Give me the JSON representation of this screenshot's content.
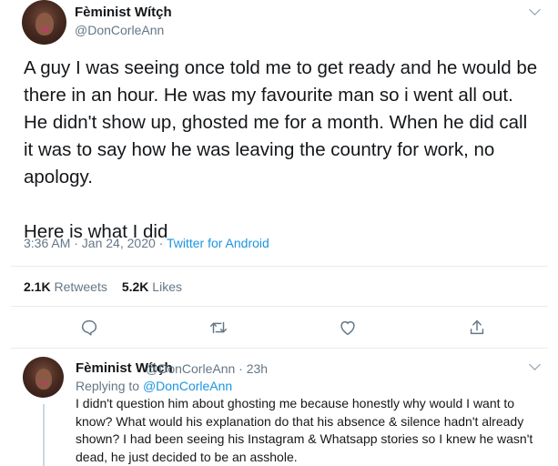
{
  "tweet": {
    "author_name": "Fèminist Wítçh",
    "author_handle": "@DonCorleAnn",
    "text": "A guy I was seeing once told me to get ready and he would be there in an hour. He was my favourite man so i went all out. He didn't show up, ghosted me for a month. When he did call it was to say how he was leaving the country for work, no apology.\n\nHere is what I did",
    "timestamp": "3:36 AM · Jan 24, 2020",
    "separator": " · ",
    "source": "Twitter for Android",
    "retweets_count": "2.1K",
    "retweets_label": "Retweets",
    "likes_count": "5.2K",
    "likes_label": "Likes"
  },
  "actions": {
    "reply_icon": "comment-icon",
    "retweet_icon": "retweet-icon",
    "like_icon": "heart-icon",
    "share_icon": "share-icon"
  },
  "reply": {
    "author_name": "Fèminist Wítçh",
    "author_handle_time": "@DonCorleAnn · 23h",
    "replying_to_label": "Replying to",
    "replying_to_handle": "@DonCorleAnn",
    "text": "I didn't question him about ghosting me because honestly why would I want to know? What would his explanation do that his absence & silence hadn't already shown? I had been seeing his Instagram & Whatsapp stories so I knew he wasn't dead, he just decided to be an asshole."
  },
  "colors": {
    "link": "#1b95e0",
    "secondary_text": "#657786",
    "primary_text": "#14171a",
    "divider": "#e6ecf0"
  }
}
